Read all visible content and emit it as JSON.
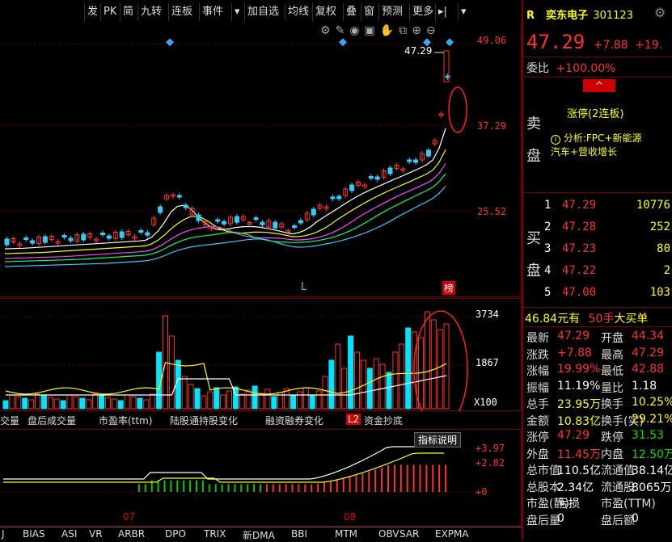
{
  "toolbar": {
    "items": [
      "发",
      "PK",
      "简",
      "九转",
      "连板",
      "事件",
      "▾",
      "加自选",
      "均线",
      "复权",
      "叠",
      "窗",
      "预测",
      "更多",
      "▸|",
      "▾"
    ]
  },
  "main_chart": {
    "price_max_label": "49.06",
    "price_mid_label": "37.29",
    "price_low_label": "25.52",
    "last_price_tag": "47.29",
    "marker_L": "L",
    "marker_rank": "榜"
  },
  "vol_chart": {
    "top_label": "3734",
    "mid_label": "1867",
    "unit_label": "X100"
  },
  "indicator_tabs": [
    "交量",
    "盘后成交量",
    "市盈率(ttm)",
    "陆股通持股变化",
    "融资融券变化",
    "L2",
    "资金抄底"
  ],
  "bottom_chart": {
    "tooltip": "指标说明",
    "label1": "+3.97",
    "label2": "+2.82",
    "label3": "+0",
    "month1": "07",
    "month2": "08"
  },
  "bottom_tabs": [
    "J",
    "BIAS",
    "ASI",
    "VR",
    "ARBR",
    "DPO",
    "TRIX",
    "新DMA",
    "BBI",
    "MTM",
    "OBV",
    "SAR",
    "EXPMA"
  ],
  "stock": {
    "tag": "R",
    "name": "奕东电子",
    "code": "301123",
    "price": "47.29",
    "change": "+7.88",
    "change_pct": "+19.",
    "weibi_label": "委比",
    "weibi_value": "+100.00%",
    "limit_text": "涨停(2连板)",
    "analysis_icon": "i",
    "analysis_text": "分析:FPC+新能源",
    "analysis_text2": "汽车+营收增长",
    "sell_label1": "卖",
    "sell_label2": "盘",
    "buy_label1": "买",
    "buy_label2": "盘"
  },
  "buy_book": [
    {
      "level": "1",
      "price": "47.29",
      "vol": "10776"
    },
    {
      "level": "2",
      "price": "47.28",
      "vol": "252"
    },
    {
      "level": "3",
      "price": "47.23",
      "vol": "80"
    },
    {
      "level": "4",
      "price": "47.22",
      "vol": "2"
    },
    {
      "level": "5",
      "price": "47.00",
      "vol": "103"
    }
  ],
  "big_order": {
    "price": "46.84",
    "text1": "元有",
    "qty": "50手",
    "text2": "大买单"
  },
  "quote": [
    {
      "k1": "最新",
      "v1": "47.29",
      "c1": "red",
      "k2": "开盘",
      "v2": "44.34",
      "c2": "red"
    },
    {
      "k1": "涨跌",
      "v1": "+7.88",
      "c1": "red",
      "k2": "最高",
      "v2": "47.29",
      "c2": "red"
    },
    {
      "k1": "涨幅",
      "v1": "19.99%",
      "c1": "red",
      "k2": "最低",
      "v2": "42.88",
      "c2": "red"
    },
    {
      "k1": "振幅",
      "v1": "11.19%",
      "c1": "white",
      "k2": "量比",
      "v2": "1.18",
      "c2": "white"
    },
    {
      "k1": "总手",
      "v1": "23.95万",
      "c1": "yellow",
      "k2": "换手",
      "v2": "10.25%",
      "c2": "yellow"
    },
    {
      "k1": "金额",
      "v1": "10.83亿",
      "c1": "yellow",
      "k2": "换手(实)",
      "v2": "29.21%",
      "c2": "yellow"
    },
    {
      "k1": "涨停",
      "v1": "47.29",
      "c1": "red",
      "k2": "跌停",
      "v2": "31.53",
      "c2": "green"
    },
    {
      "k1": "外盘",
      "v1": "11.45万",
      "c1": "red",
      "k2": "内盘",
      "v2": "12.50万",
      "c2": "green"
    },
    {
      "k1": "总市值",
      "v1": "110.5亿",
      "c1": "white",
      "k2": "流通值",
      "v2": "38.14亿",
      "c2": "white"
    },
    {
      "k1": "总股本",
      "v1": "2.34亿",
      "c1": "white",
      "k2": "流通股",
      "v2": "8065万",
      "c2": "white"
    },
    {
      "k1": "市盈(静)",
      "v1": "亏损",
      "c1": "white",
      "k2": "市盈(TTM)",
      "v2": "",
      "c2": "white"
    },
    {
      "k1": "盘后量",
      "v1": "0",
      "c1": "white",
      "k2": "盘后额",
      "v2": "0",
      "c2": "white"
    }
  ],
  "colors": {
    "up": "#ff3030",
    "down": "#33ccff",
    "frame": "#7a0000"
  }
}
